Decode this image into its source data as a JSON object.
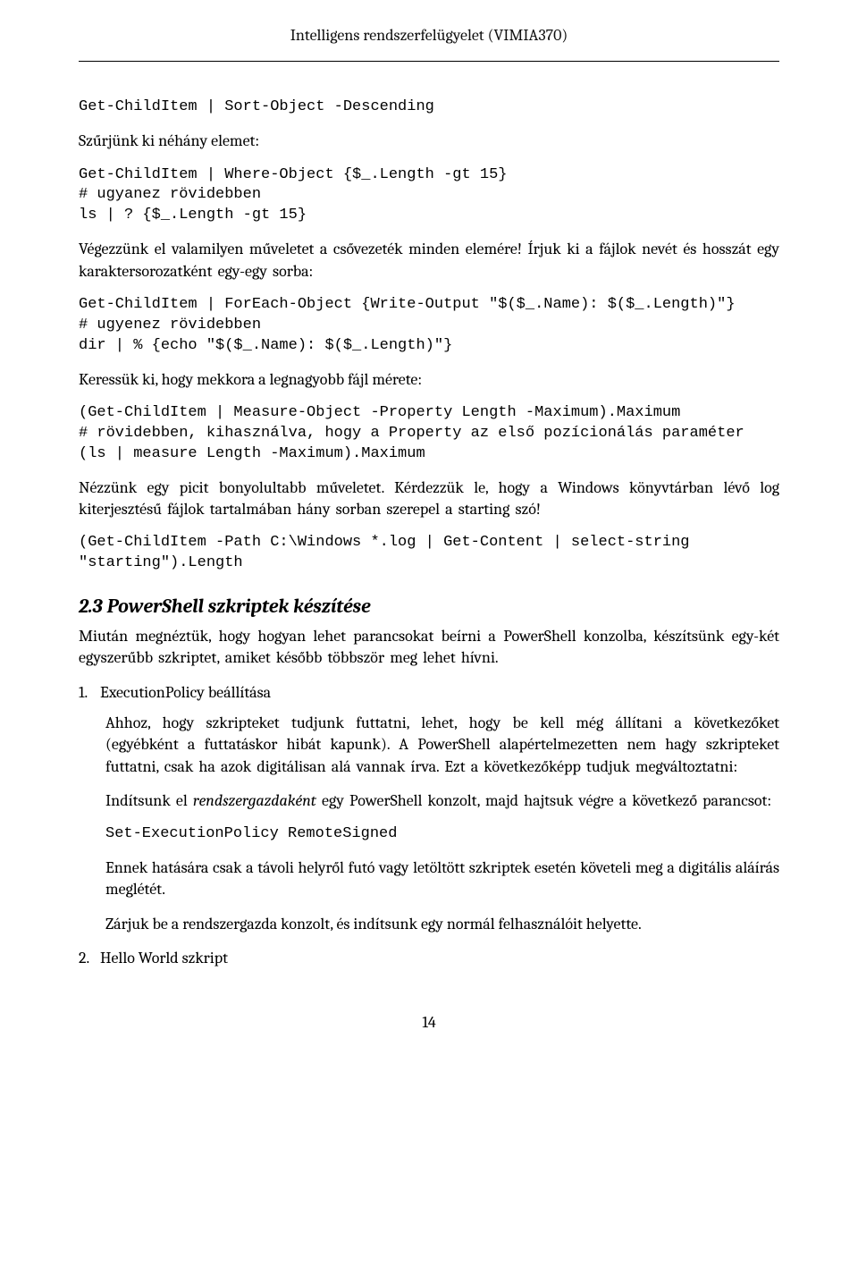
{
  "header": {
    "title": "Intelligens rendszerfelügyelet (VIMIA370)"
  },
  "code1": "Get-ChildItem | Sort-Object -Descending",
  "para1": "Szűrjünk ki néhány elemet:",
  "code2": "Get-ChildItem | Where-Object {$_.Length -gt 15}\n# ugyanez rövidebben\nls | ? {$_.Length -gt 15}",
  "para2": "Végezzünk el valamilyen műveletet a csővezeték minden elemére! Írjuk ki a fájlok nevét és hosszát egy karaktersorozatként egy-egy sorba:",
  "code3": "Get-ChildItem | ForEach-Object {Write-Output \"$($_.Name): $($_.Length)\"}\n# ugyenez rövidebben\ndir | % {echo \"$($_.Name): $($_.Length)\"}",
  "para3": "Keressük ki, hogy mekkora a legnagyobb fájl mérete:",
  "code4": "(Get-ChildItem | Measure-Object -Property Length -Maximum).Maximum\n# rövidebben, kihasználva, hogy a Property az első pozícionálás paraméter\n(ls | measure Length -Maximum).Maximum",
  "para4": "Nézzünk egy picit bonyolultabb műveletet. Kérdezzük le, hogy a Windows könyvtárban lévő log kiterjesztésű fájlok tartalmában hány sorban szerepel a starting szó!",
  "code5": "(Get-ChildItem -Path C:\\Windows *.log | Get-Content | select-string \"starting\").Length",
  "section": {
    "number": "2.3",
    "title": "PowerShell szkriptek készítése"
  },
  "para5": "Miután megnéztük, hogy hogyan lehet parancsokat beírni a PowerShell konzolba, készítsünk egy-két egyszerűbb szkriptet, amiket később többször meg lehet hívni.",
  "list": {
    "item1": {
      "num": "1.",
      "title": "ExecutionPolicy beállítása",
      "p1": "Ahhoz, hogy szkripteket tudjunk futtatni, lehet, hogy be kell még állítani a következőket (egyébként a futtatáskor hibát kapunk). A PowerShell alapértelmezetten nem hagy szkripteket futtatni, csak ha azok digitálisan alá vannak írva. Ezt a következőképp tudjuk megváltoztatni:",
      "p2a": "Indítsunk el ",
      "p2em": "rendszergazdaként",
      "p2b": " egy PowerShell konzolt, majd hajtsuk végre a következő parancsot:",
      "code": "Set-ExecutionPolicy RemoteSigned",
      "p3": "Ennek hatására csak a távoli helyről futó vagy letöltött szkriptek esetén követeli meg a digitális aláírás meglétét.",
      "p4": "Zárjuk be a rendszergazda konzolt, és indítsunk egy normál felhasználóit helyette."
    },
    "item2": {
      "num": "2.",
      "title": "Hello World szkript"
    }
  },
  "pagenum": "14"
}
